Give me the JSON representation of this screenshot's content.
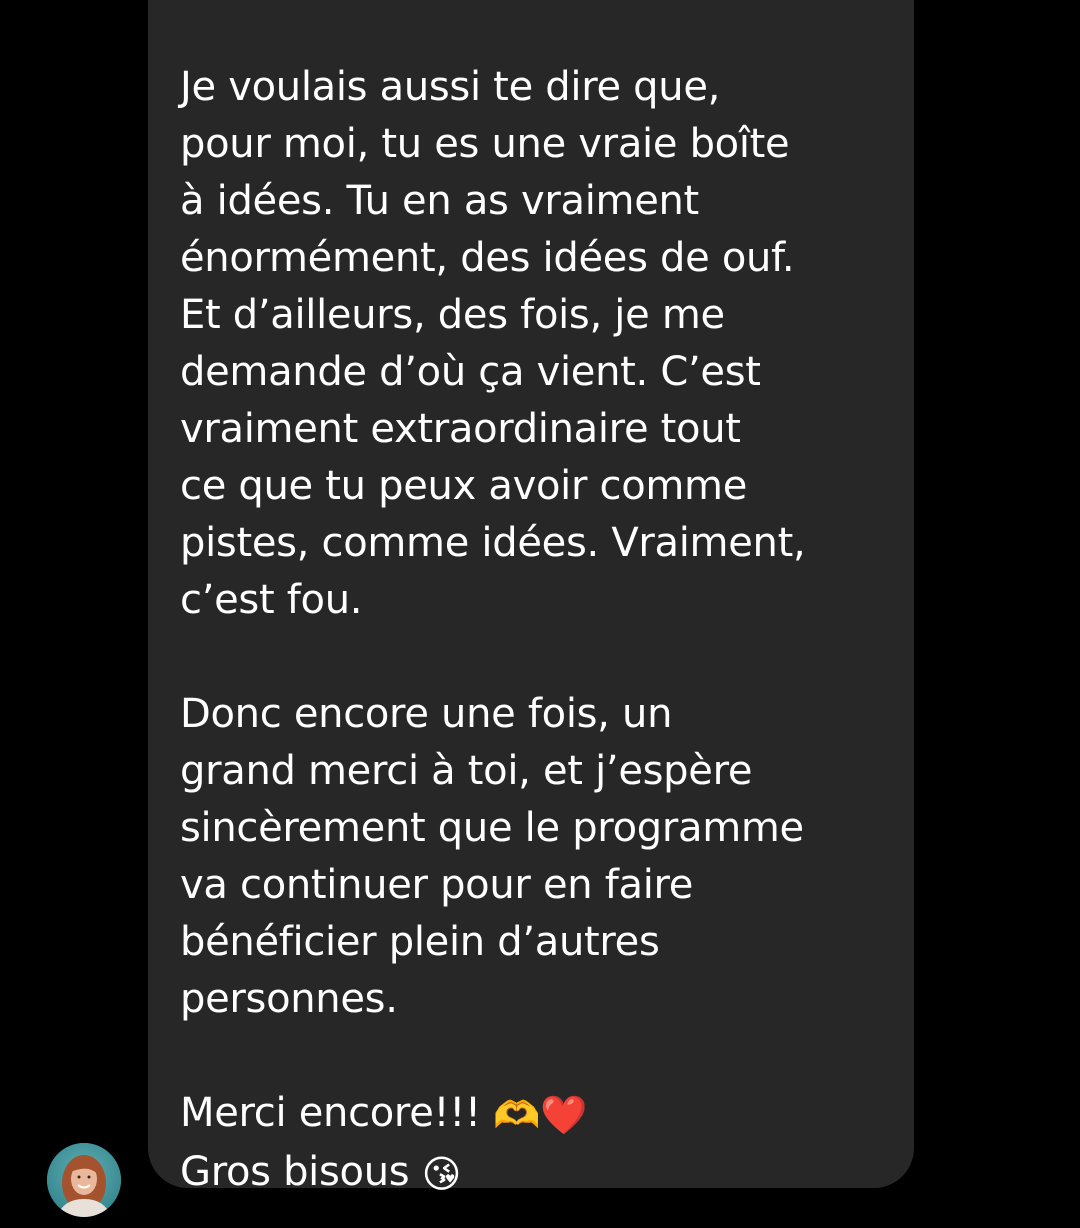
{
  "message": {
    "paragraph1": [
      "Je voulais aussi te dire que,",
      "pour moi, tu es une vraie boîte",
      "à idées. Tu en as vraiment",
      "énormément, des idées de ouf.",
      "Et d’ailleurs, des fois, je me",
      "demande d’où ça vient. C’est",
      "vraiment extraordinaire tout",
      "ce que tu peux avoir comme",
      "pistes, comme idées. Vraiment,",
      "c’est fou."
    ],
    "paragraph2": [
      "Donc encore une fois, un",
      "grand merci à toi, et j’espère",
      "sincèrement que le programme",
      "va continuer pour en faire",
      "bénéficier plein d’autres",
      "personnes."
    ],
    "closing_line1": "Merci encore!!!",
    "closing_line1_emoji1": "🫶",
    "closing_line1_emoji2": "❤️",
    "closing_line2": "Gros bisous",
    "closing_line2_emoji": "😘"
  },
  "sender": {
    "avatar_icon": "profile-photo-icon"
  },
  "colors": {
    "background": "#000000",
    "bubble": "#272727",
    "text": "#ffffff"
  }
}
